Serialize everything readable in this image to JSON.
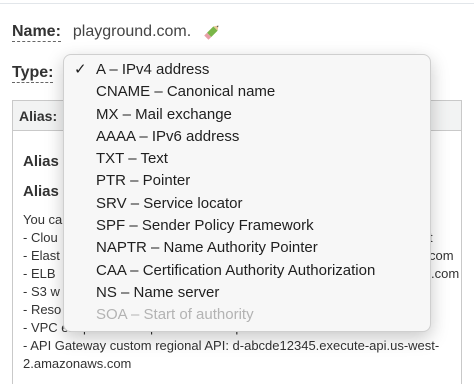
{
  "form": {
    "name_label": "Name:",
    "name_value": "playground.com.",
    "type_label": "Type:"
  },
  "panel": {
    "header": "Alias:",
    "alias_line_1": "Alias",
    "alias_line_2": "Alias",
    "lines": [
      "You ca",
      "- Clou",
      "- Elast",
      "- ELB",
      "- S3 w",
      "- Reso",
      "- VPC endpoint: example.us-east-2.vpce.amazonaws.com",
      "- API Gateway custom regional API: d-abcde12345.execute-api.us-west-2.amazonaws.com"
    ],
    "peek_right": [
      "t",
      "com",
      ".com"
    ]
  },
  "dropdown": {
    "check_glyph": "✓",
    "options": [
      {
        "label": "A – IPv4 address",
        "selected": true
      },
      {
        "label": "CNAME – Canonical name"
      },
      {
        "label": "MX – Mail exchange"
      },
      {
        "label": "AAAA – IPv6 address"
      },
      {
        "label": "TXT – Text"
      },
      {
        "label": "PTR – Pointer"
      },
      {
        "label": "SRV – Service locator"
      },
      {
        "label": "SPF – Sender Policy Framework"
      },
      {
        "label": "NAPTR – Name Authority Pointer"
      },
      {
        "label": "CAA – Certification Authority Authorization"
      },
      {
        "label": "NS – Name server"
      },
      {
        "label": "SOA – Start of authority",
        "disabled": true
      }
    ]
  },
  "icons": {
    "edit": "pencil-icon",
    "check": "checkmark-icon"
  },
  "colors": {
    "disabled_text": "#b3b3b3",
    "panel_header_bg": "#f2f3f3"
  }
}
